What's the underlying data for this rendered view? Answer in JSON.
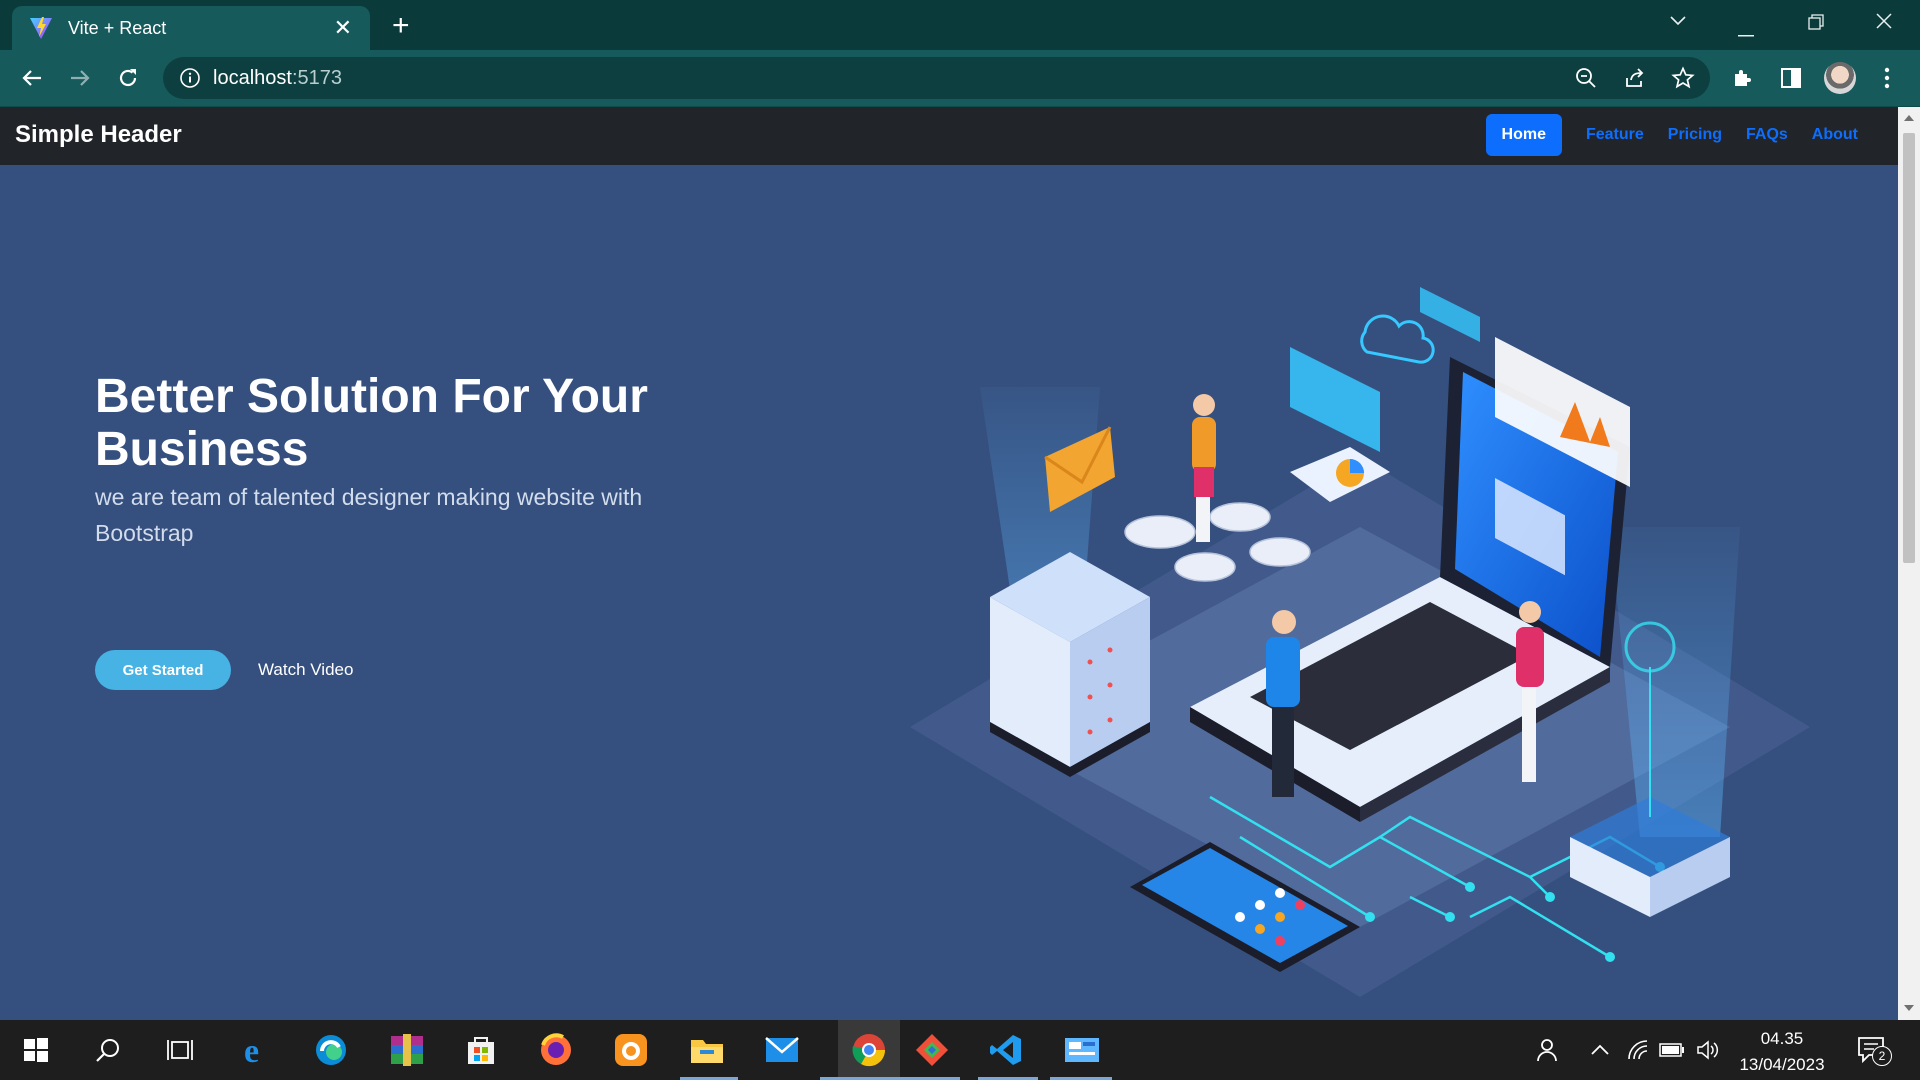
{
  "browser": {
    "tab_title": "Vite + React",
    "url_host": "localhost",
    "url_port": ":5173"
  },
  "site": {
    "brand": "Simple Header",
    "nav": [
      {
        "label": "Home",
        "active": true
      },
      {
        "label": "Feature"
      },
      {
        "label": "Pricing"
      },
      {
        "label": "FAQs"
      },
      {
        "label": "About"
      }
    ]
  },
  "hero": {
    "title": "Better Solution For Your Business",
    "subtitle": "we are team of talented designer making website with Bootstrap",
    "primary_button": "Get Started",
    "secondary_button": "Watch Video"
  },
  "taskbar": {
    "time": "04.35",
    "date": "13/04/2023",
    "notification_count": "2"
  },
  "colors": {
    "hero_bg": "#35507f",
    "header_bg": "#212529",
    "nav_accent": "#0d6efd",
    "cta": "#47b2e4",
    "browser_chrome": "#165a5c"
  }
}
